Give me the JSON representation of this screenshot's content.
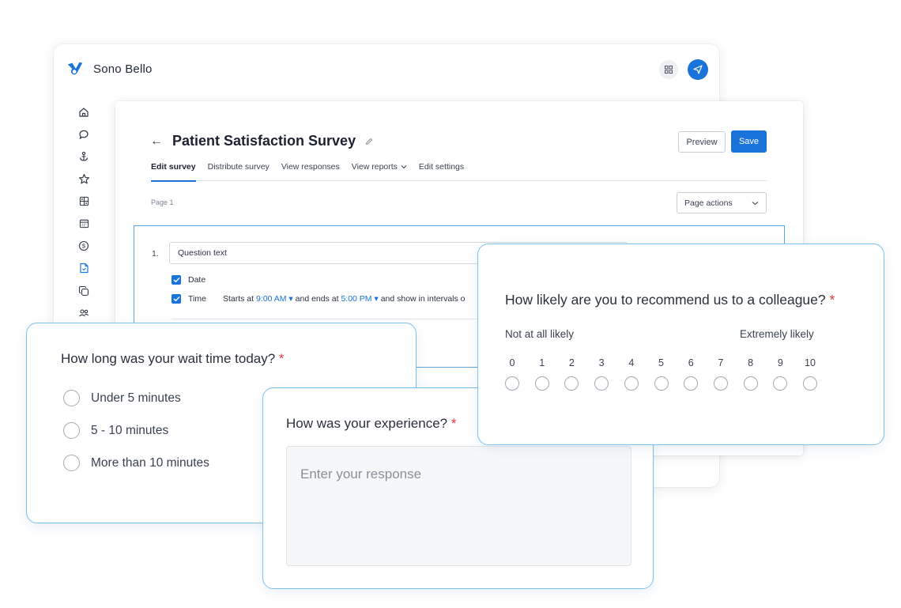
{
  "app": {
    "name": "Sono Bello",
    "accent_color": "#1a73d9",
    "icons": [
      "grid-icon",
      "send-icon"
    ]
  },
  "sidebar": {
    "items": [
      {
        "icon": "home-icon"
      },
      {
        "icon": "chat-bubble-icon"
      },
      {
        "icon": "anchor-icon"
      },
      {
        "icon": "star-icon"
      },
      {
        "icon": "widgets-icon"
      },
      {
        "icon": "calendar-icon"
      },
      {
        "icon": "dollar-icon"
      },
      {
        "icon": "document-icon",
        "active": true
      },
      {
        "icon": "copy-icon"
      },
      {
        "icon": "users-icon"
      }
    ]
  },
  "editor": {
    "title": "Patient Satisfaction Survey",
    "preview_label": "Preview",
    "save_label": "Save",
    "tabs": [
      {
        "label": "Edit survey",
        "active": true
      },
      {
        "label": "Distribute survey"
      },
      {
        "label": "View responses"
      },
      {
        "label": "View reports",
        "has_dropdown": true
      },
      {
        "label": "Edit settings"
      }
    ],
    "page_label": "Page 1",
    "page_actions_label": "Page actions",
    "question": {
      "number": "1.",
      "text_value": "Question text",
      "options": [
        {
          "label": "Date",
          "checked": true
        },
        {
          "label": "Time",
          "checked": true
        }
      ],
      "time_config": {
        "prefix": "Starts at",
        "start": "9:00 AM",
        "middle": "and ends at",
        "end": "5:00 PM",
        "suffix": "and show in intervals o"
      }
    }
  },
  "card_wait": {
    "question": "How long was your wait time today?",
    "required_mark": "*",
    "options": [
      "Under 5 minutes",
      "5 - 10 minutes",
      "More than 10 minutes"
    ]
  },
  "card_experience": {
    "question": "How was your experience?",
    "required_mark": "*",
    "placeholder": "Enter your response"
  },
  "card_nps": {
    "question": "How likely are you to recommend us to a colleague?",
    "required_mark": "*",
    "low_label": "Not at all likely",
    "high_label": "Extremely likely",
    "scale": [
      "0",
      "1",
      "2",
      "3",
      "4",
      "5",
      "6",
      "7",
      "8",
      "9",
      "10"
    ]
  }
}
